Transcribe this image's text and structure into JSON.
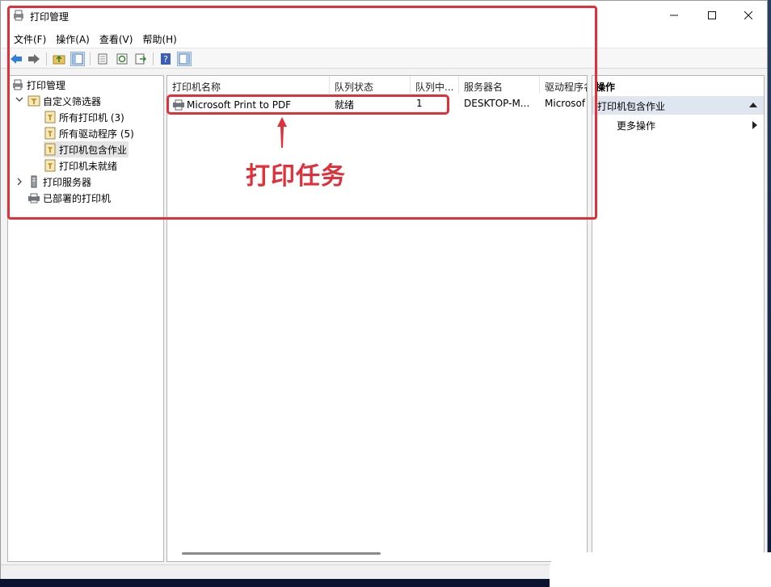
{
  "window": {
    "title": "打印管理",
    "controls": [
      "minimize",
      "maximize",
      "close"
    ]
  },
  "menu": [
    {
      "label": "文件(F)"
    },
    {
      "label": "操作(A)"
    },
    {
      "label": "查看(V)"
    },
    {
      "label": "帮助(H)"
    }
  ],
  "toolbar": {
    "buttons": [
      "back-icon",
      "forward-icon",
      "up-folder-icon",
      "show-tree-icon",
      "properties-icon",
      "refresh-icon",
      "export-icon",
      "help-icon",
      "show-action-pane-icon"
    ]
  },
  "tree": {
    "root": "打印管理",
    "custom_filters": "自定义筛选器",
    "all_printers": "所有打印机 (3)",
    "all_drivers": "所有驱动程序 (5)",
    "printers_with_jobs": "打印机包含作业",
    "printers_not_ready": "打印机未就绪",
    "print_servers": "打印服务器",
    "deployed_printers": "已部署的打印机"
  },
  "list": {
    "columns": [
      "打印机名称",
      "队列状态",
      "队列中...",
      "服务器名",
      "驱动程序名"
    ],
    "rows": [
      {
        "name": "Microsoft Print to PDF",
        "status": "就绪",
        "jobs": "1",
        "server": "DESKTOP-M...",
        "driver": "Microsof"
      }
    ]
  },
  "actions": {
    "header": "操作",
    "section": "打印机包含作业",
    "more": "更多操作"
  },
  "annotation": {
    "label": "打印任务",
    "color": "#e0303a"
  }
}
